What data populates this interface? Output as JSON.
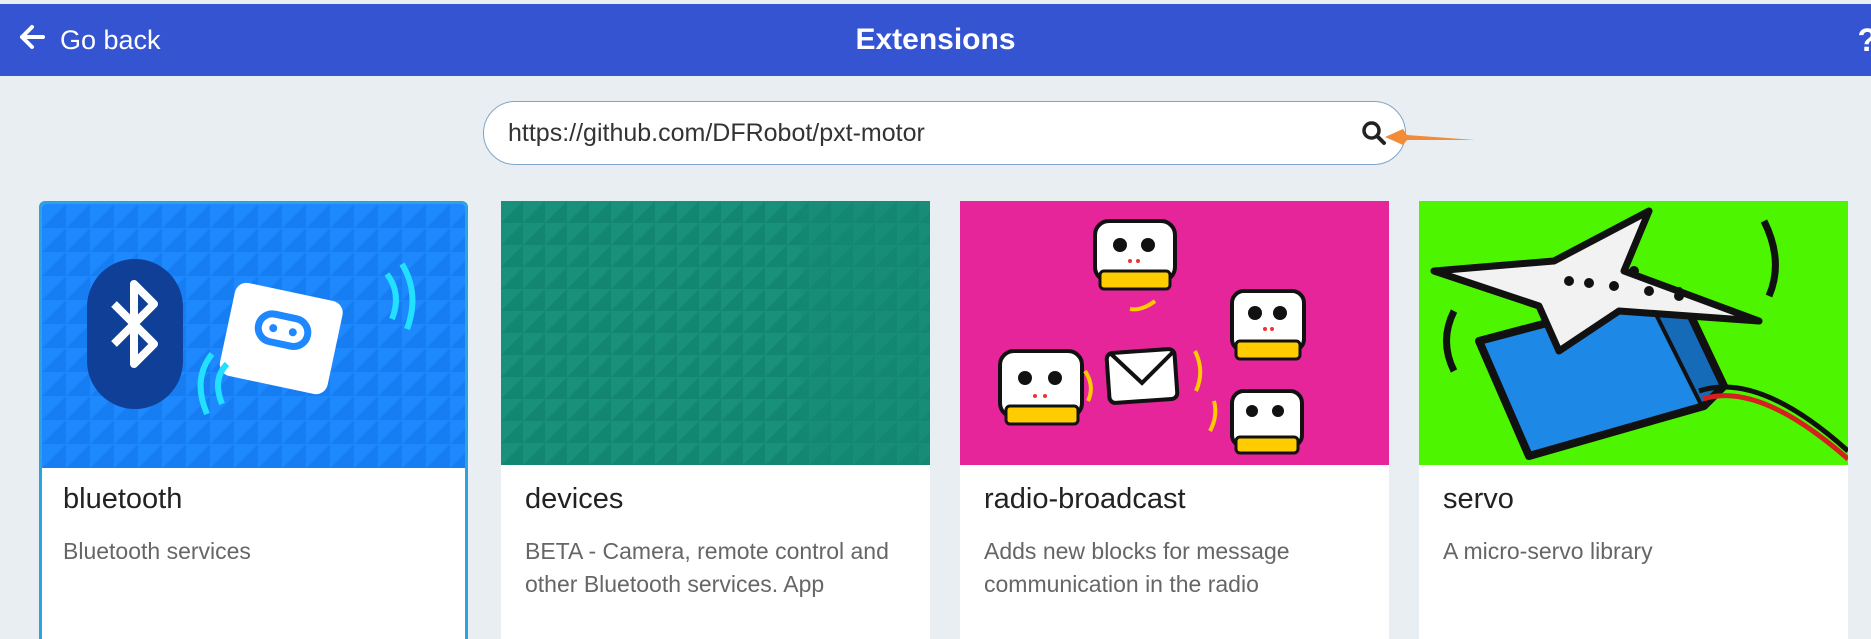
{
  "header": {
    "back_label": "Go back",
    "title": "Extensions",
    "help_glyph": "?"
  },
  "search": {
    "value": "https://github.com/DFRobot/pxt-motor",
    "icon": "search-icon"
  },
  "annotation": {
    "color": "#f28c38"
  },
  "cards": [
    {
      "name": "bluetooth",
      "description": "Bluetooth services",
      "bg": "#1e88ff"
    },
    {
      "name": "devices",
      "description": "BETA - Camera, remote control and other Bluetooth services. App",
      "bg": "#19907a"
    },
    {
      "name": "radio-broadcast",
      "description": "Adds new blocks for message communication in the radio",
      "bg": "#e7259a"
    },
    {
      "name": "servo",
      "description": "A micro-servo library",
      "bg": "#4df500"
    }
  ],
  "colors": {
    "header": "#3454d1",
    "selected_border": "#29a3e2"
  }
}
